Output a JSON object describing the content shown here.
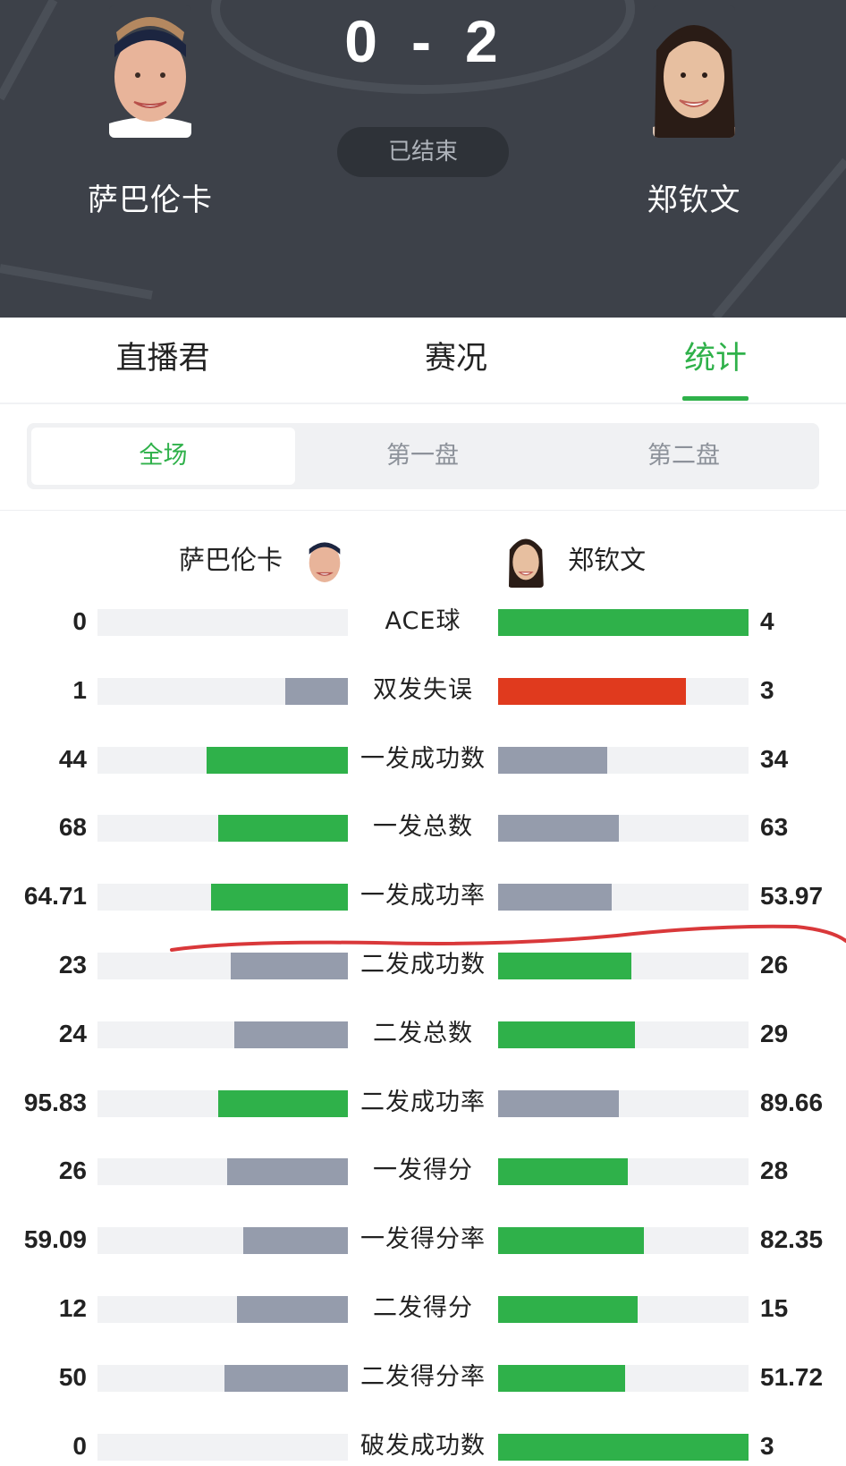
{
  "match": {
    "player1": {
      "name": "萨巴伦卡"
    },
    "player2": {
      "name": "郑钦文"
    },
    "score_p1": "0",
    "score_dash": "-",
    "score_p2": "2",
    "status": "已结束"
  },
  "tabs": [
    "直播君",
    "赛况",
    "统计"
  ],
  "active_tab": 2,
  "segments": [
    "全场",
    "第一盘",
    "第二盘"
  ],
  "active_segment": 0,
  "colors": {
    "header_bg": "#3d4149",
    "accent_green": "#2fb14a",
    "bar_gray": "#959cac",
    "bar_red": "#e03a1e",
    "track": "#f1f2f4"
  },
  "stats": [
    {
      "label": "ACE球",
      "left": "0",
      "right": "4",
      "left_frac": 0.0,
      "right_frac": 1.0,
      "left_color": "gray",
      "right_color": "green"
    },
    {
      "label": "双发失误",
      "left": "1",
      "right": "3",
      "left_frac": 0.25,
      "right_frac": 0.75,
      "left_color": "gray",
      "right_color": "red"
    },
    {
      "label": "一发成功数",
      "left": "44",
      "right": "34",
      "left_frac": 0.564,
      "right_frac": 0.436,
      "left_color": "green",
      "right_color": "gray"
    },
    {
      "label": "一发总数",
      "left": "68",
      "right": "63",
      "left_frac": 0.519,
      "right_frac": 0.481,
      "left_color": "green",
      "right_color": "gray"
    },
    {
      "label": "一发成功率",
      "left": "64.71",
      "right": "53.97",
      "left_frac": 0.545,
      "right_frac": 0.455,
      "left_color": "green",
      "right_color": "gray"
    },
    {
      "label": "二发成功数",
      "left": "23",
      "right": "26",
      "left_frac": 0.469,
      "right_frac": 0.531,
      "left_color": "gray",
      "right_color": "green"
    },
    {
      "label": "二发总数",
      "left": "24",
      "right": "29",
      "left_frac": 0.453,
      "right_frac": 0.547,
      "left_color": "gray",
      "right_color": "green"
    },
    {
      "label": "二发成功率",
      "left": "95.83",
      "right": "89.66",
      "left_frac": 0.517,
      "right_frac": 0.483,
      "left_color": "green",
      "right_color": "gray"
    },
    {
      "label": "一发得分",
      "left": "26",
      "right": "28",
      "left_frac": 0.481,
      "right_frac": 0.519,
      "left_color": "gray",
      "right_color": "green"
    },
    {
      "label": "一发得分率",
      "left": "59.09",
      "right": "82.35",
      "left_frac": 0.418,
      "right_frac": 0.582,
      "left_color": "gray",
      "right_color": "green"
    },
    {
      "label": "二发得分",
      "left": "12",
      "right": "15",
      "left_frac": 0.444,
      "right_frac": 0.556,
      "left_color": "gray",
      "right_color": "green"
    },
    {
      "label": "二发得分率",
      "left": "50",
      "right": "51.72",
      "left_frac": 0.492,
      "right_frac": 0.508,
      "left_color": "gray",
      "right_color": "green"
    },
    {
      "label": "破发成功数",
      "left": "0",
      "right": "3",
      "left_frac": 0.0,
      "right_frac": 1.0,
      "left_color": "gray",
      "right_color": "green"
    }
  ]
}
